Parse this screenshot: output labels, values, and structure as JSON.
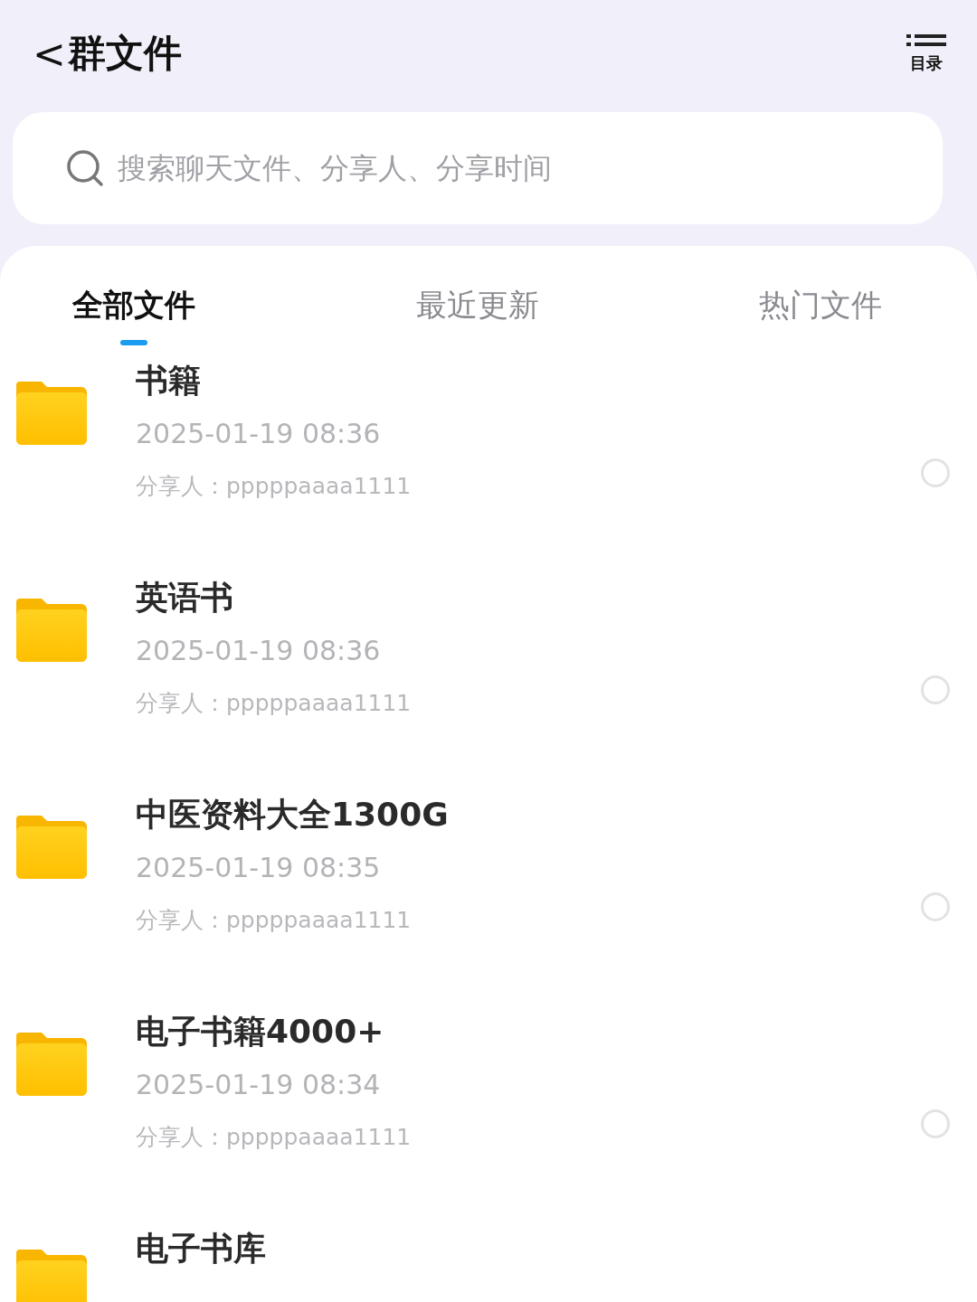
{
  "header": {
    "back": "<",
    "title": "群文件",
    "menu_label": "目录"
  },
  "search": {
    "placeholder": "搜索聊天文件、分享人、分享时间"
  },
  "tabs": [
    {
      "label": "全部文件",
      "selected": true
    },
    {
      "label": "最近更新",
      "selected": false
    },
    {
      "label": "热门文件",
      "selected": false
    }
  ],
  "files": [
    {
      "name": "书籍",
      "time": "2025-01-19 08:36",
      "sharer_label": "分享人：",
      "sharer": "pppppaaaa1111",
      "selected": false
    },
    {
      "name": "英语书",
      "time": "2025-01-19 08:36",
      "sharer_label": "分享人：",
      "sharer": "pppppaaaa1111",
      "selected": false
    },
    {
      "name": "中医资料大全1300G",
      "time": "2025-01-19 08:35",
      "sharer_label": "分享人：",
      "sharer": "pppppaaaa1111",
      "selected": false
    },
    {
      "name": "电子书籍4000+",
      "time": "2025-01-19 08:34",
      "sharer_label": "分享人：",
      "sharer": "pppppaaaa1111",
      "selected": false
    },
    {
      "name": "电子书库"
    }
  ]
}
